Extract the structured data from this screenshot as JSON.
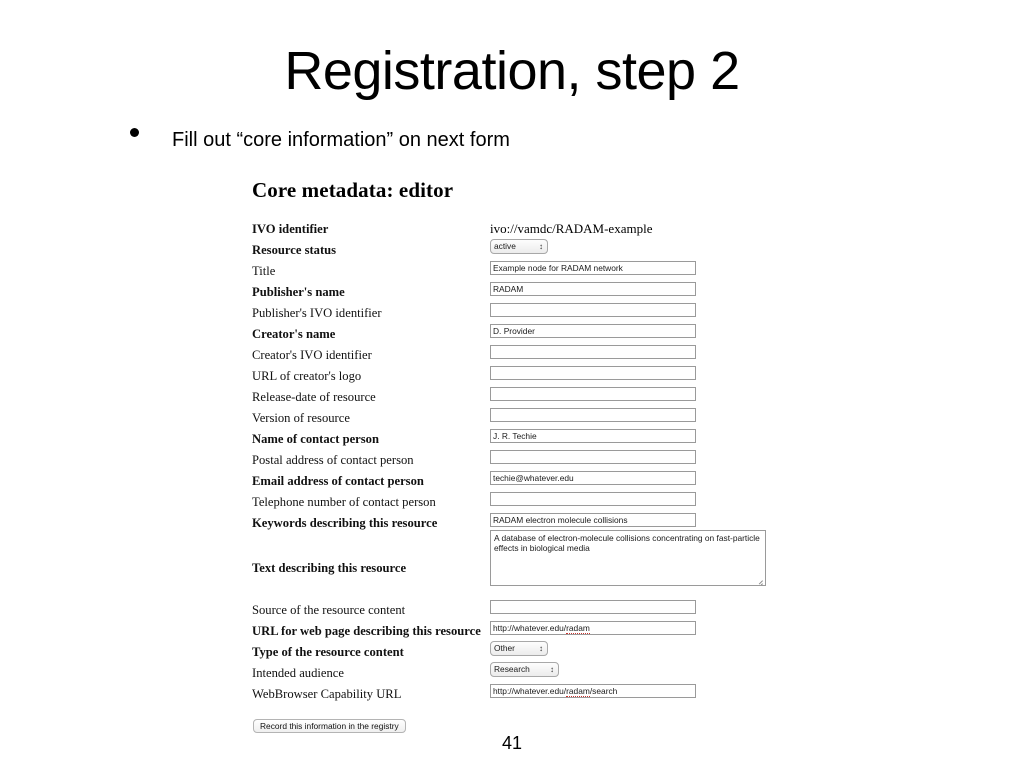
{
  "slide": {
    "title": "Registration, step 2",
    "bullet": "Fill out “core information” on next form",
    "page_number": "41"
  },
  "form": {
    "heading": "Core metadata: editor",
    "submit_label": "Record this information in the registry",
    "select_arrows": "↕",
    "rows": [
      {
        "label": "IVO identifier",
        "bold": true,
        "control": "static",
        "value": "ivo://vamdc/RADAM-example"
      },
      {
        "label": "Resource status",
        "bold": true,
        "control": "select",
        "value": "active"
      },
      {
        "label": "Title",
        "bold": false,
        "control": "text",
        "value": "Example node for RADAM network"
      },
      {
        "label": "Publisher's name",
        "bold": true,
        "control": "text",
        "value": "RADAM"
      },
      {
        "label": "Publisher's IVO identifier",
        "bold": false,
        "control": "text",
        "value": ""
      },
      {
        "label": "Creator's name",
        "bold": true,
        "control": "text",
        "value": "D. Provider"
      },
      {
        "label": "Creator's IVO identifier",
        "bold": false,
        "control": "text",
        "value": ""
      },
      {
        "label": "URL of creator's logo",
        "bold": false,
        "control": "text",
        "value": ""
      },
      {
        "label": "Release-date of resource",
        "bold": false,
        "control": "text",
        "value": ""
      },
      {
        "label": "Version of resource",
        "bold": false,
        "control": "text",
        "value": ""
      },
      {
        "label": "Name of contact person",
        "bold": true,
        "control": "text",
        "value": "J. R. Techie"
      },
      {
        "label": "Postal address of contact person",
        "bold": false,
        "control": "text",
        "value": ""
      },
      {
        "label": "Email address of contact person",
        "bold": true,
        "control": "text",
        "value": "techie@whatever.edu"
      },
      {
        "label": "Telephone number of contact person",
        "bold": false,
        "control": "text",
        "value": ""
      },
      {
        "label": "Keywords describing this resource",
        "bold": true,
        "control": "text",
        "value": "RADAM electron molecule collisions"
      },
      {
        "label": "Text describing this resource",
        "bold": true,
        "control": "textarea",
        "value": "A database of electron-molecule collisions concentrating on fast-particle effects in biological media"
      },
      {
        "label": "Source of the resource content",
        "bold": false,
        "control": "text",
        "value": ""
      },
      {
        "label": "URL for web page describing this resource",
        "bold": true,
        "control": "url",
        "value_before": "http://whatever.edu/",
        "value_misspelled": "radam",
        "value_after": ""
      },
      {
        "label": "Type of the resource content",
        "bold": true,
        "control": "select",
        "value": "Other"
      },
      {
        "label": "Intended audience",
        "bold": false,
        "control": "select",
        "value": "Research"
      },
      {
        "label": "WebBrowser Capability URL",
        "bold": false,
        "control": "url",
        "value_before": "http://whatever.edu/",
        "value_misspelled": "radam",
        "value_after": "/search"
      }
    ]
  }
}
